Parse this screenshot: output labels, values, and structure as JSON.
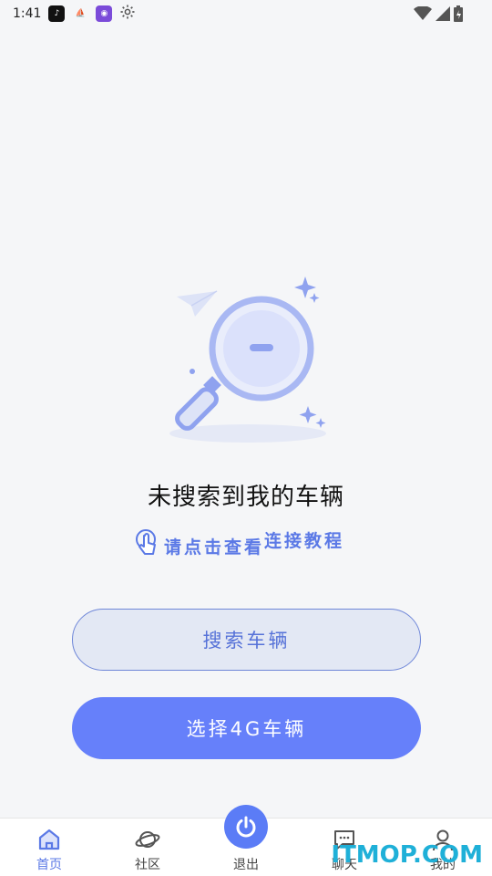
{
  "status_bar": {
    "time": "1:41"
  },
  "empty_state": {
    "title": "未搜索到我的车辆",
    "tutorial_prefix": "请点击查看",
    "tutorial_link": "连接教程"
  },
  "actions": {
    "search_label": "搜索车辆",
    "select_4g_label": "选择4G车辆"
  },
  "tabs": [
    {
      "label": "首页",
      "icon": "home-icon",
      "active": true
    },
    {
      "label": "社区",
      "icon": "planet-icon",
      "active": false
    },
    {
      "label": "退出",
      "icon": "power-icon",
      "active": false
    },
    {
      "label": "聊天",
      "icon": "chat-icon",
      "active": false
    },
    {
      "label": "我的",
      "icon": "profile-icon",
      "active": false
    }
  ],
  "watermark": "ITMOP.COM",
  "colors": {
    "accent": "#6680fa",
    "link": "#5b79e6",
    "background": "#f5f6f8"
  }
}
